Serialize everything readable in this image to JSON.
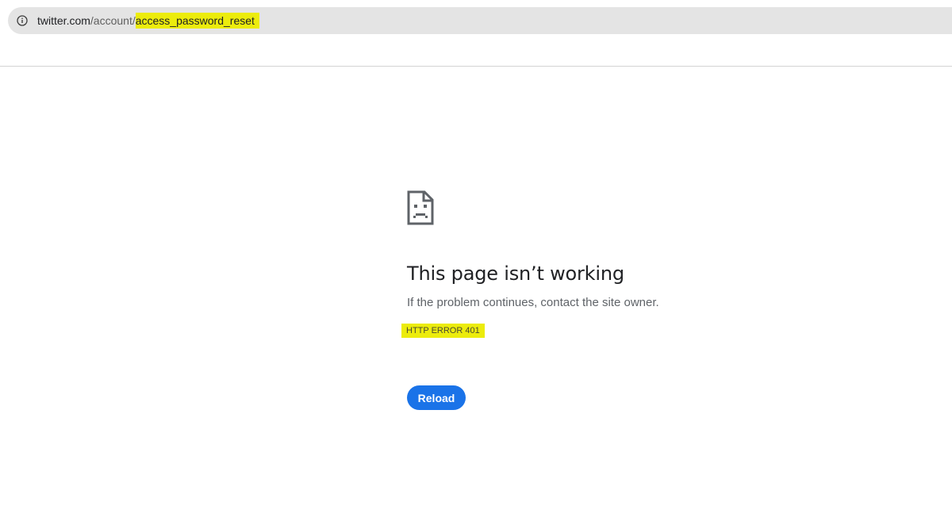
{
  "browser": {
    "url_host": "twitter.com",
    "url_path": "/account/",
    "url_highlighted": "access_password_reset"
  },
  "error_page": {
    "icon": "sad-page-icon",
    "title": "This page isn’t working",
    "message": "If the problem continues, contact the site owner.",
    "error_code": "HTTP ERROR 401",
    "reload_label": "Reload"
  },
  "colors": {
    "highlight": "#ecec0c",
    "button": "#1a73e8",
    "omnibox": "#e4e4e4"
  }
}
